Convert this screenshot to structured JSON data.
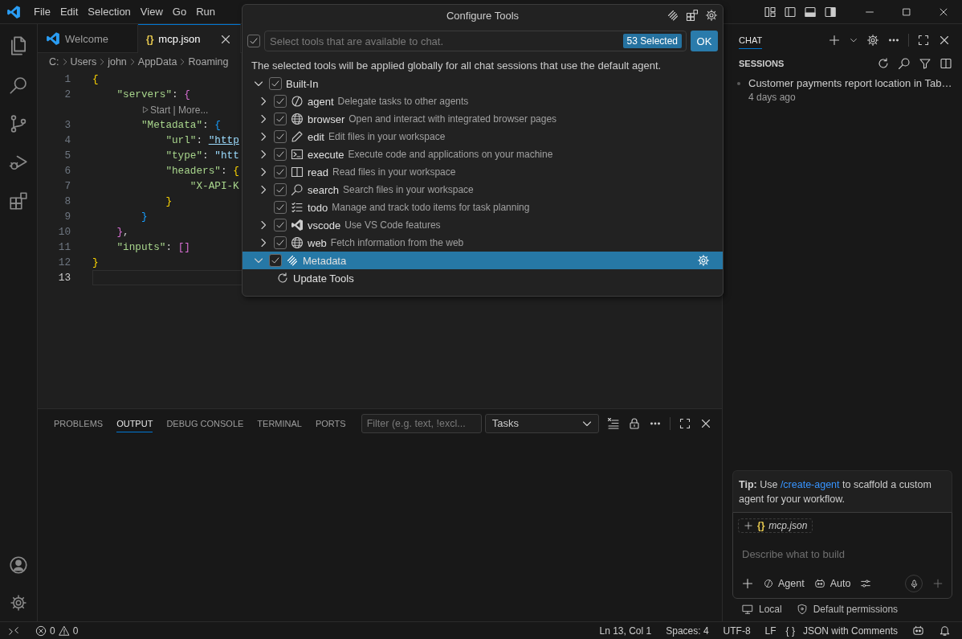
{
  "window": {
    "menu": [
      "File",
      "Edit",
      "Selection",
      "View",
      "Go",
      "Run"
    ]
  },
  "editor": {
    "tabs": [
      {
        "label": "Welcome",
        "kind": "welcome",
        "selected": false
      },
      {
        "label": "mcp.json",
        "kind": "json",
        "icon": "{}",
        "selected": true
      }
    ],
    "breadcrumb": [
      "C:",
      "Users",
      "john",
      "AppData",
      "Roaming"
    ],
    "lines": [
      {
        "kind": "code",
        "number": "1",
        "current": false,
        "tokens": [
          {
            "text": "{",
            "kind": "brace1"
          }
        ]
      },
      {
        "kind": "code",
        "number": "2",
        "current": false,
        "tokens": [
          {
            "text": "    \"servers\"",
            "kind": "key"
          },
          {
            "text": ": ",
            "kind": "punct"
          },
          {
            "text": "{",
            "kind": "brace2"
          }
        ]
      },
      {
        "kind": "codelens",
        "text": "        Start | More..."
      },
      {
        "kind": "code",
        "number": "3",
        "current": false,
        "tokens": [
          {
            "text": "        \"Metadata\"",
            "kind": "key"
          },
          {
            "text": ": ",
            "kind": "punct"
          },
          {
            "text": "{",
            "kind": "brace3"
          }
        ]
      },
      {
        "kind": "code",
        "number": "4",
        "current": false,
        "tokens": [
          {
            "text": "            \"url\"",
            "kind": "key"
          },
          {
            "text": ": ",
            "kind": "punct"
          },
          {
            "text": "\"http",
            "kind": "link"
          }
        ]
      },
      {
        "kind": "code",
        "number": "5",
        "current": false,
        "tokens": [
          {
            "text": "            \"type\"",
            "kind": "key"
          },
          {
            "text": ": ",
            "kind": "punct"
          },
          {
            "text": "\"htt",
            "kind": "string"
          }
        ]
      },
      {
        "kind": "code",
        "number": "6",
        "current": false,
        "tokens": [
          {
            "text": "            \"headers\"",
            "kind": "key"
          },
          {
            "text": ": ",
            "kind": "punct"
          },
          {
            "text": "{",
            "kind": "brace1"
          }
        ]
      },
      {
        "kind": "code",
        "number": "7",
        "current": false,
        "tokens": [
          {
            "text": "                \"X-API-K",
            "kind": "key"
          }
        ]
      },
      {
        "kind": "code",
        "number": "8",
        "current": false,
        "tokens": [
          {
            "text": "            }",
            "kind": "brace1"
          }
        ]
      },
      {
        "kind": "code",
        "number": "9",
        "current": false,
        "tokens": [
          {
            "text": "        }",
            "kind": "brace3"
          }
        ]
      },
      {
        "kind": "code",
        "number": "10",
        "current": false,
        "tokens": [
          {
            "text": "    }",
            "kind": "brace2"
          },
          {
            "text": ",",
            "kind": "punct"
          }
        ]
      },
      {
        "kind": "code",
        "number": "11",
        "current": false,
        "tokens": [
          {
            "text": "    \"inputs\"",
            "kind": "key"
          },
          {
            "text": ": ",
            "kind": "punct"
          },
          {
            "text": "[]",
            "kind": "brace2"
          }
        ]
      },
      {
        "kind": "code",
        "number": "12",
        "current": false,
        "tokens": [
          {
            "text": "}",
            "kind": "brace1"
          }
        ]
      },
      {
        "kind": "code",
        "number": "13",
        "current": true
      }
    ]
  },
  "panel": {
    "tabs": [
      {
        "label": "PROBLEMS",
        "selected": false
      },
      {
        "label": "OUTPUT",
        "selected": true
      },
      {
        "label": "DEBUG CONSOLE",
        "selected": false
      },
      {
        "label": "TERMINAL",
        "selected": false
      },
      {
        "label": "PORTS",
        "selected": false
      }
    ],
    "filter": {
      "placeholder": "Filter (e.g. text, !excl..."
    },
    "dropdown": "Tasks"
  },
  "dialog": {
    "title": "Configure Tools",
    "all_checked": true,
    "search": {
      "placeholder": "Select tools that are available to chat."
    },
    "badge": "53 Selected",
    "ok": "OK",
    "description": "The selected tools will be applied globally for all chat sessions that use the default agent.",
    "groups": [
      {
        "label": "Built-In",
        "expanded": true,
        "checked": true,
        "selected": false,
        "children": [
          {
            "kind": "tool",
            "name": "agent",
            "description": "Delegate tasks to other agents",
            "checked": true,
            "expandable": true
          },
          {
            "kind": "tool",
            "name": "browser",
            "description": "Open and interact with integrated browser pages",
            "checked": true,
            "expandable": true
          },
          {
            "kind": "tool",
            "name": "edit",
            "description": "Edit files in your workspace",
            "checked": true,
            "expandable": true
          },
          {
            "kind": "tool",
            "name": "execute",
            "description": "Execute code and applications on your machine",
            "checked": true,
            "expandable": true
          },
          {
            "kind": "tool",
            "name": "read",
            "description": "Read files in your workspace",
            "checked": true,
            "expandable": true
          },
          {
            "kind": "tool",
            "name": "search",
            "description": "Search files in your workspace",
            "checked": true,
            "expandable": true
          },
          {
            "kind": "tool",
            "name": "todo",
            "description": "Manage and track todo items for task planning",
            "checked": true,
            "expandable": false
          },
          {
            "kind": "tool",
            "name": "vscode",
            "description": "Use VS Code features",
            "checked": true,
            "expandable": true
          },
          {
            "kind": "tool",
            "name": "web",
            "description": "Fetch information from the web",
            "checked": true,
            "expandable": true
          }
        ]
      },
      {
        "label": "Metadata",
        "expanded": true,
        "checked": true,
        "selected": true,
        "children": [
          {
            "kind": "action",
            "name": "Update Tools"
          }
        ]
      }
    ]
  },
  "chat": {
    "tabs": [
      {
        "label": "CHAT",
        "selected": true
      }
    ],
    "sessions_title": "SESSIONS",
    "sessions": [
      {
        "title": "Customer payments report location in Tab…",
        "time": "4 days ago"
      }
    ],
    "tip": {
      "text": "**Tip:** Use ",
      "link": "/create-agent",
      "after": " to scaffold a custom agent for your workflow."
    },
    "attachment": {
      "icon": "{}",
      "label": "mcp.json"
    },
    "input": {
      "placeholder": "Describe what to build"
    },
    "mode": "Agent",
    "model": "Auto",
    "footer": [
      "Local",
      "Default permissions"
    ]
  },
  "status_bar": {
    "errors": "0",
    "warnings": "0",
    "position": "Ln 13, Col 1",
    "indent": "Spaces: 4",
    "encoding": "UTF-8",
    "eol": "LF",
    "language_icon": "{ }",
    "language": "JSON with Comments"
  }
}
